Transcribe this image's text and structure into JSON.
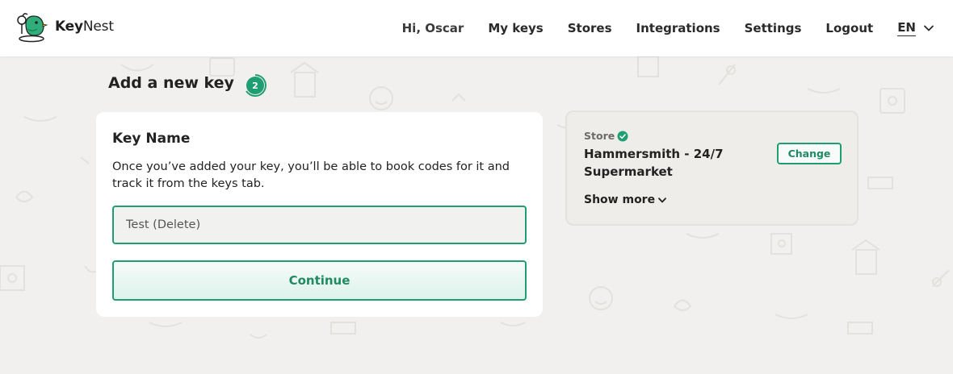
{
  "brand": {
    "name_bold": "Key",
    "name_rest": "Nest",
    "logo_icon": "bird-logo-icon"
  },
  "nav": {
    "greeting": "Hi, Oscar",
    "items": [
      {
        "label": "My keys"
      },
      {
        "label": "Stores"
      },
      {
        "label": "Integrations"
      },
      {
        "label": "Settings"
      },
      {
        "label": "Logout"
      }
    ],
    "language": "EN",
    "language_icon": "chevron-down-icon"
  },
  "page": {
    "title": "Add a new key",
    "step": "2"
  },
  "key_form": {
    "title": "Key Name",
    "description": "Once you’ve added your key, you’ll be able to book codes for it and track it from the keys tab.",
    "name_value": "Test (Delete)",
    "continue_label": "Continue"
  },
  "store": {
    "label": "Store",
    "label_icon": "verified-check-icon",
    "name": "Hammersmith - 24/7 Supermarket",
    "change_label": "Change",
    "show_more_label": "Show more"
  },
  "colors": {
    "accent": "#1f9e73",
    "background": "#f1f0ee"
  }
}
